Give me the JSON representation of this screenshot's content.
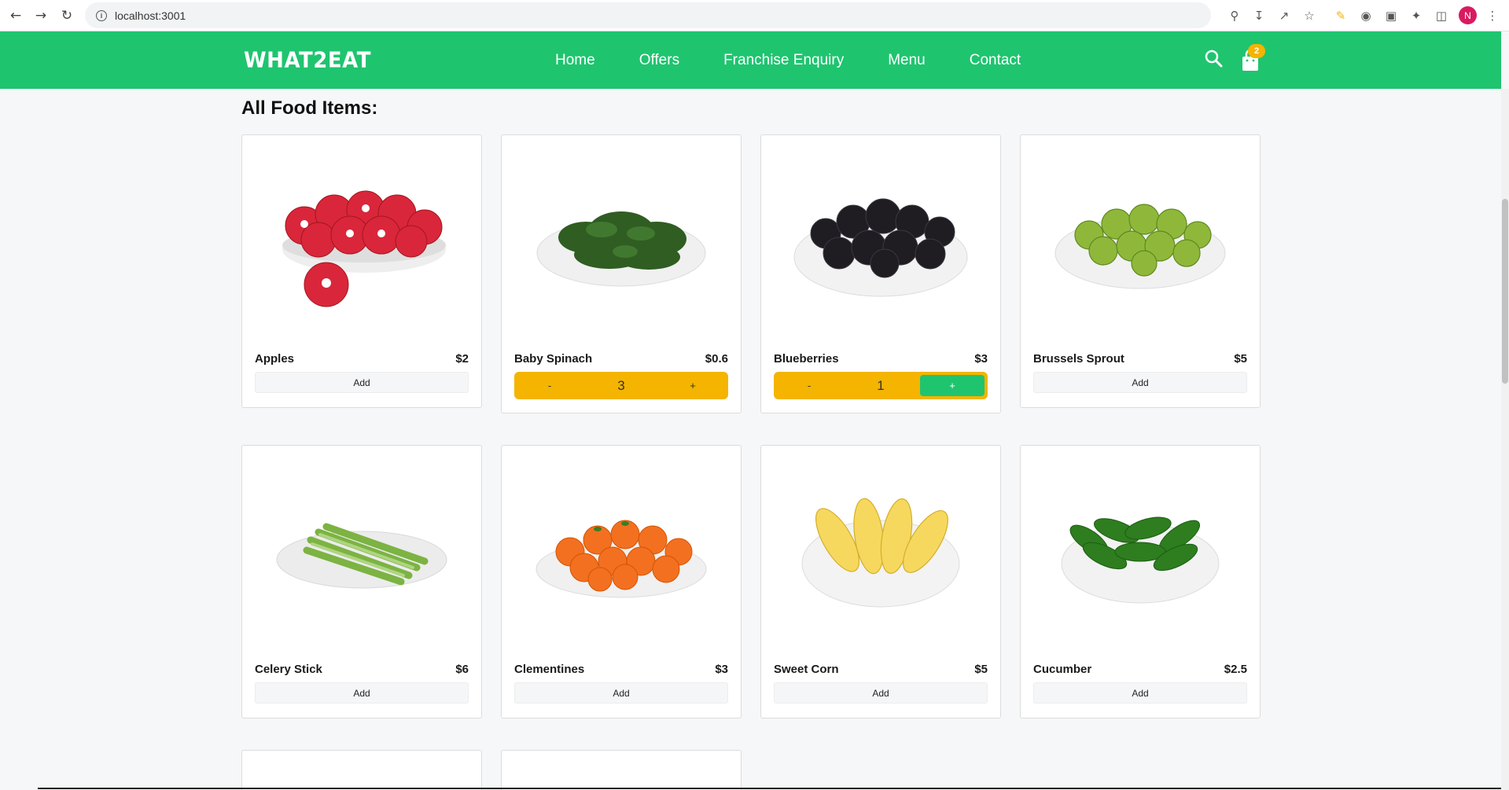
{
  "browser": {
    "url": "localhost:3001",
    "profile_initial": "N"
  },
  "header": {
    "logo": "WHAT2EAT",
    "nav": [
      "Home",
      "Offers",
      "Franchise Enquiry",
      "Menu",
      "Contact"
    ],
    "cart_count": "2",
    "brand_color": "#1fc46f",
    "accent_color": "#f4b400"
  },
  "main": {
    "title": "All Food Items:",
    "add_label": "Add",
    "minus_label": "-",
    "plus_label": "+",
    "items": [
      {
        "name": "Apples",
        "price": "$2",
        "image": "apples-bowl"
      },
      {
        "name": "Baby Spinach",
        "price": "$0.6",
        "image": "spinach-bowl",
        "quantity": "3"
      },
      {
        "name": "Blueberries",
        "price": "$3",
        "image": "blackberries-bowl",
        "quantity": "1"
      },
      {
        "name": "Brussels Sprout",
        "price": "$5",
        "image": "brussels-sprouts-bowl"
      },
      {
        "name": "Celery Stick",
        "price": "$6",
        "image": "celery-plate"
      },
      {
        "name": "Clementines",
        "price": "$3",
        "image": "clementines-plate"
      },
      {
        "name": "Sweet Corn",
        "price": "$5",
        "image": "corn-bowl"
      },
      {
        "name": "Cucumber",
        "price": "$2.5",
        "image": "cucumber-bowl"
      }
    ]
  }
}
